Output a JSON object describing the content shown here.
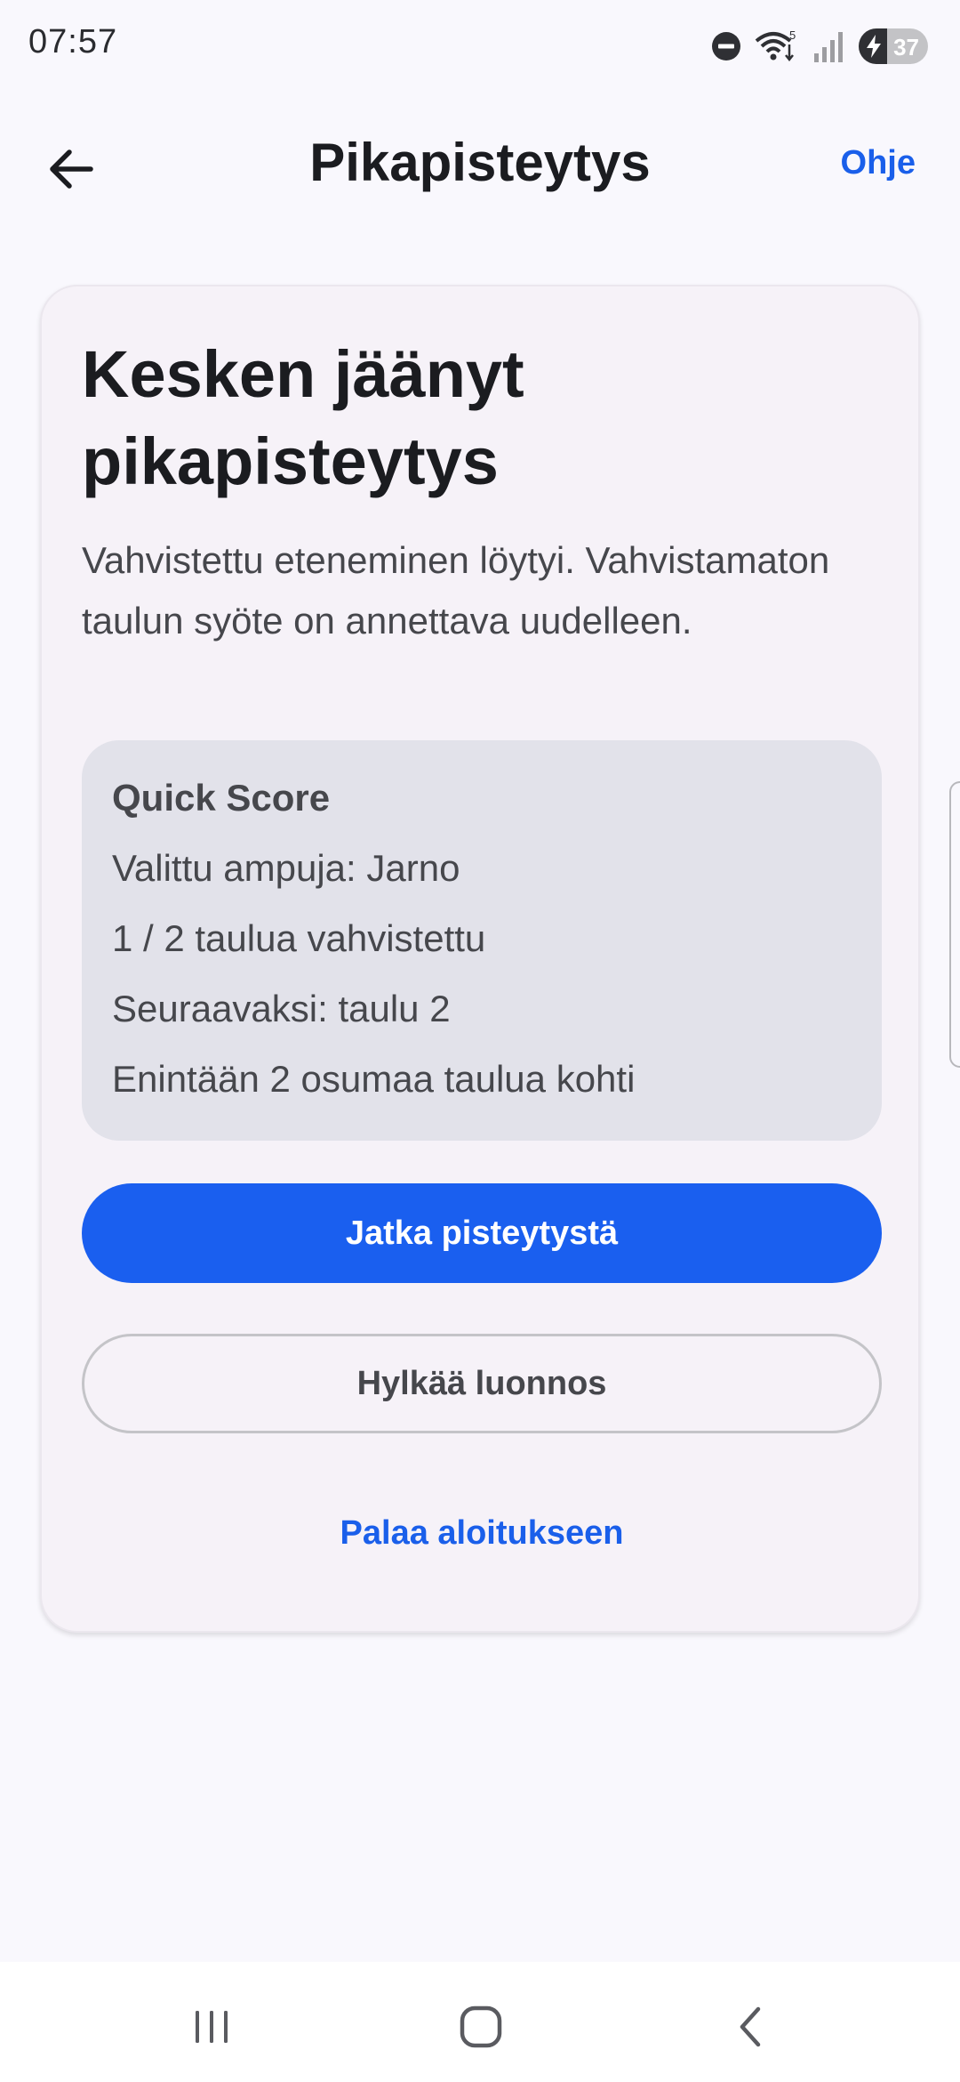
{
  "status_bar": {
    "time": "07:57",
    "battery_level": "37",
    "icons": [
      "do-not-disturb-icon",
      "wifi-icon",
      "signal-icon",
      "battery-icon"
    ]
  },
  "app_bar": {
    "title": "Pikapisteytys",
    "help_label": "Ohje",
    "back_icon": "arrow-left-icon"
  },
  "card": {
    "title": "Kesken jäänyt pikapisteytys",
    "description": "Vahvistettu eteneminen löytyi. Vahvistamaton taulun syöte on annettava uudelleen.",
    "info": {
      "heading": "Quick Score",
      "lines": [
        "Valittu ampuja: Jarno",
        "1 / 2 taulua vahvistettu",
        "Seuraavaksi: taulu 2",
        "Enintään 2 osumaa taulua kohti"
      ]
    },
    "primary_button": "Jatka pisteytystä",
    "secondary_button": "Hylkää luonnos",
    "text_button": "Palaa aloitukseen"
  },
  "colors": {
    "accent": "#1a5fef",
    "background": "#f9f8fd",
    "card": "#f6f2f8",
    "info_box": "#e2e2ea"
  },
  "nav_bar": {
    "icons": [
      "recents-icon",
      "home-icon",
      "back-icon"
    ]
  }
}
